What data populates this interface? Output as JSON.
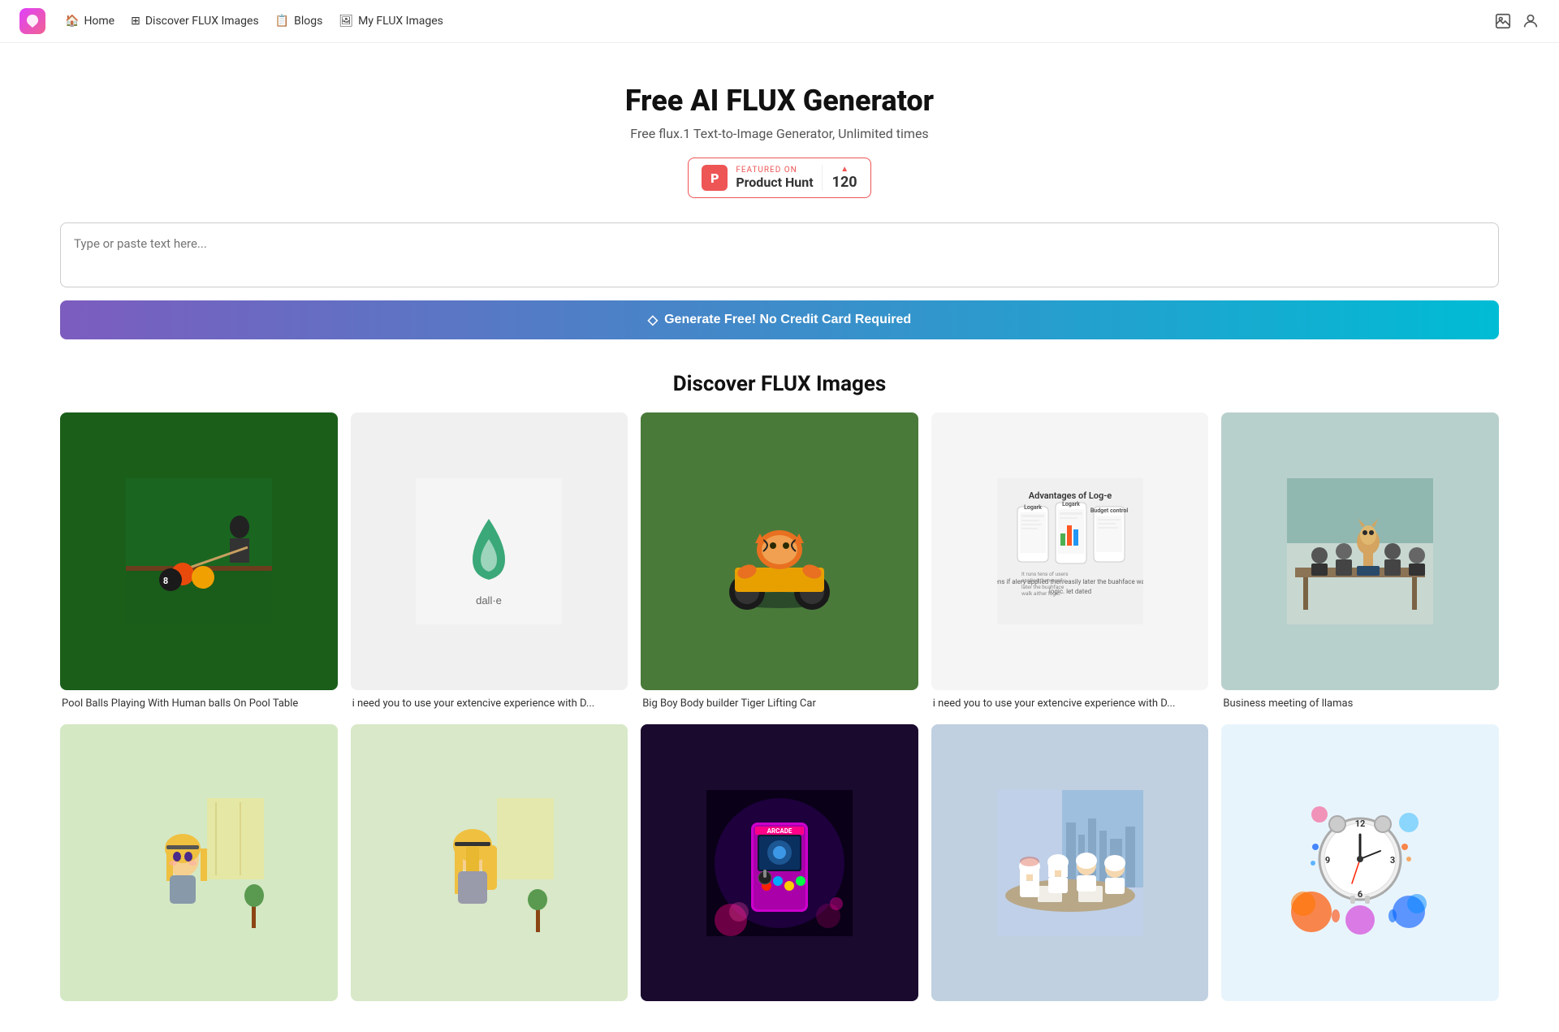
{
  "app": {
    "logo_symbol": "🪃",
    "title": "Free AI FLUX Generator"
  },
  "nav": {
    "home_label": "Home",
    "discover_label": "Discover FLUX Images",
    "blogs_label": "Blogs",
    "my_images_label": "My FLUX Images",
    "home_icon": "🏠",
    "discover_icon": "⊞",
    "blogs_icon": "📋",
    "my_images_icon": "🖼"
  },
  "hero": {
    "title": "Free AI FLUX Generator",
    "subtitle": "Free flux.1 Text-to-Image Generator, Unlimited times",
    "ph_featured_label": "FEATURED ON",
    "ph_title": "Product Hunt",
    "ph_letter": "P",
    "ph_count": "120",
    "ph_arrow": "▲"
  },
  "generator": {
    "placeholder": "Type or paste text here...",
    "button_label": "Generate Free! No Credit Card Required",
    "button_icon": "◇"
  },
  "discover": {
    "section_title": "Discover FLUX Images",
    "gallery_row1": [
      {
        "id": "pool-balls",
        "caption": "Pool Balls Playing With Human balls On Pool Table",
        "color": "#1a5e1a",
        "emoji": "🎱"
      },
      {
        "id": "dalle",
        "caption": "i need you to use your extencive experience with D...",
        "color": "#f0f0f0",
        "emoji": "💧"
      },
      {
        "id": "tiger",
        "caption": "Big Boy Body builder Tiger Lifting Car",
        "color": "#3a7a3a",
        "emoji": "🐯"
      },
      {
        "id": "loge",
        "caption": "i need you to use your extencive experience with D...",
        "color": "#f5f5f5",
        "emoji": "📱"
      },
      {
        "id": "llama",
        "caption": "Business meeting of llamas",
        "color": "#c8d8e0",
        "emoji": "🦙"
      }
    ],
    "gallery_row2": [
      {
        "id": "anime1",
        "caption": "",
        "color": "#d4e8c4",
        "emoji": "🎌"
      },
      {
        "id": "anime2",
        "caption": "",
        "color": "#d4e8c4",
        "emoji": "🎌"
      },
      {
        "id": "arcade",
        "caption": "",
        "color": "#1a0a2e",
        "emoji": "🕹"
      },
      {
        "id": "arab",
        "caption": "",
        "color": "#c8d8e8",
        "emoji": "🤝"
      },
      {
        "id": "clock",
        "caption": "",
        "color": "#e8f0f8",
        "emoji": "⏰"
      }
    ]
  }
}
